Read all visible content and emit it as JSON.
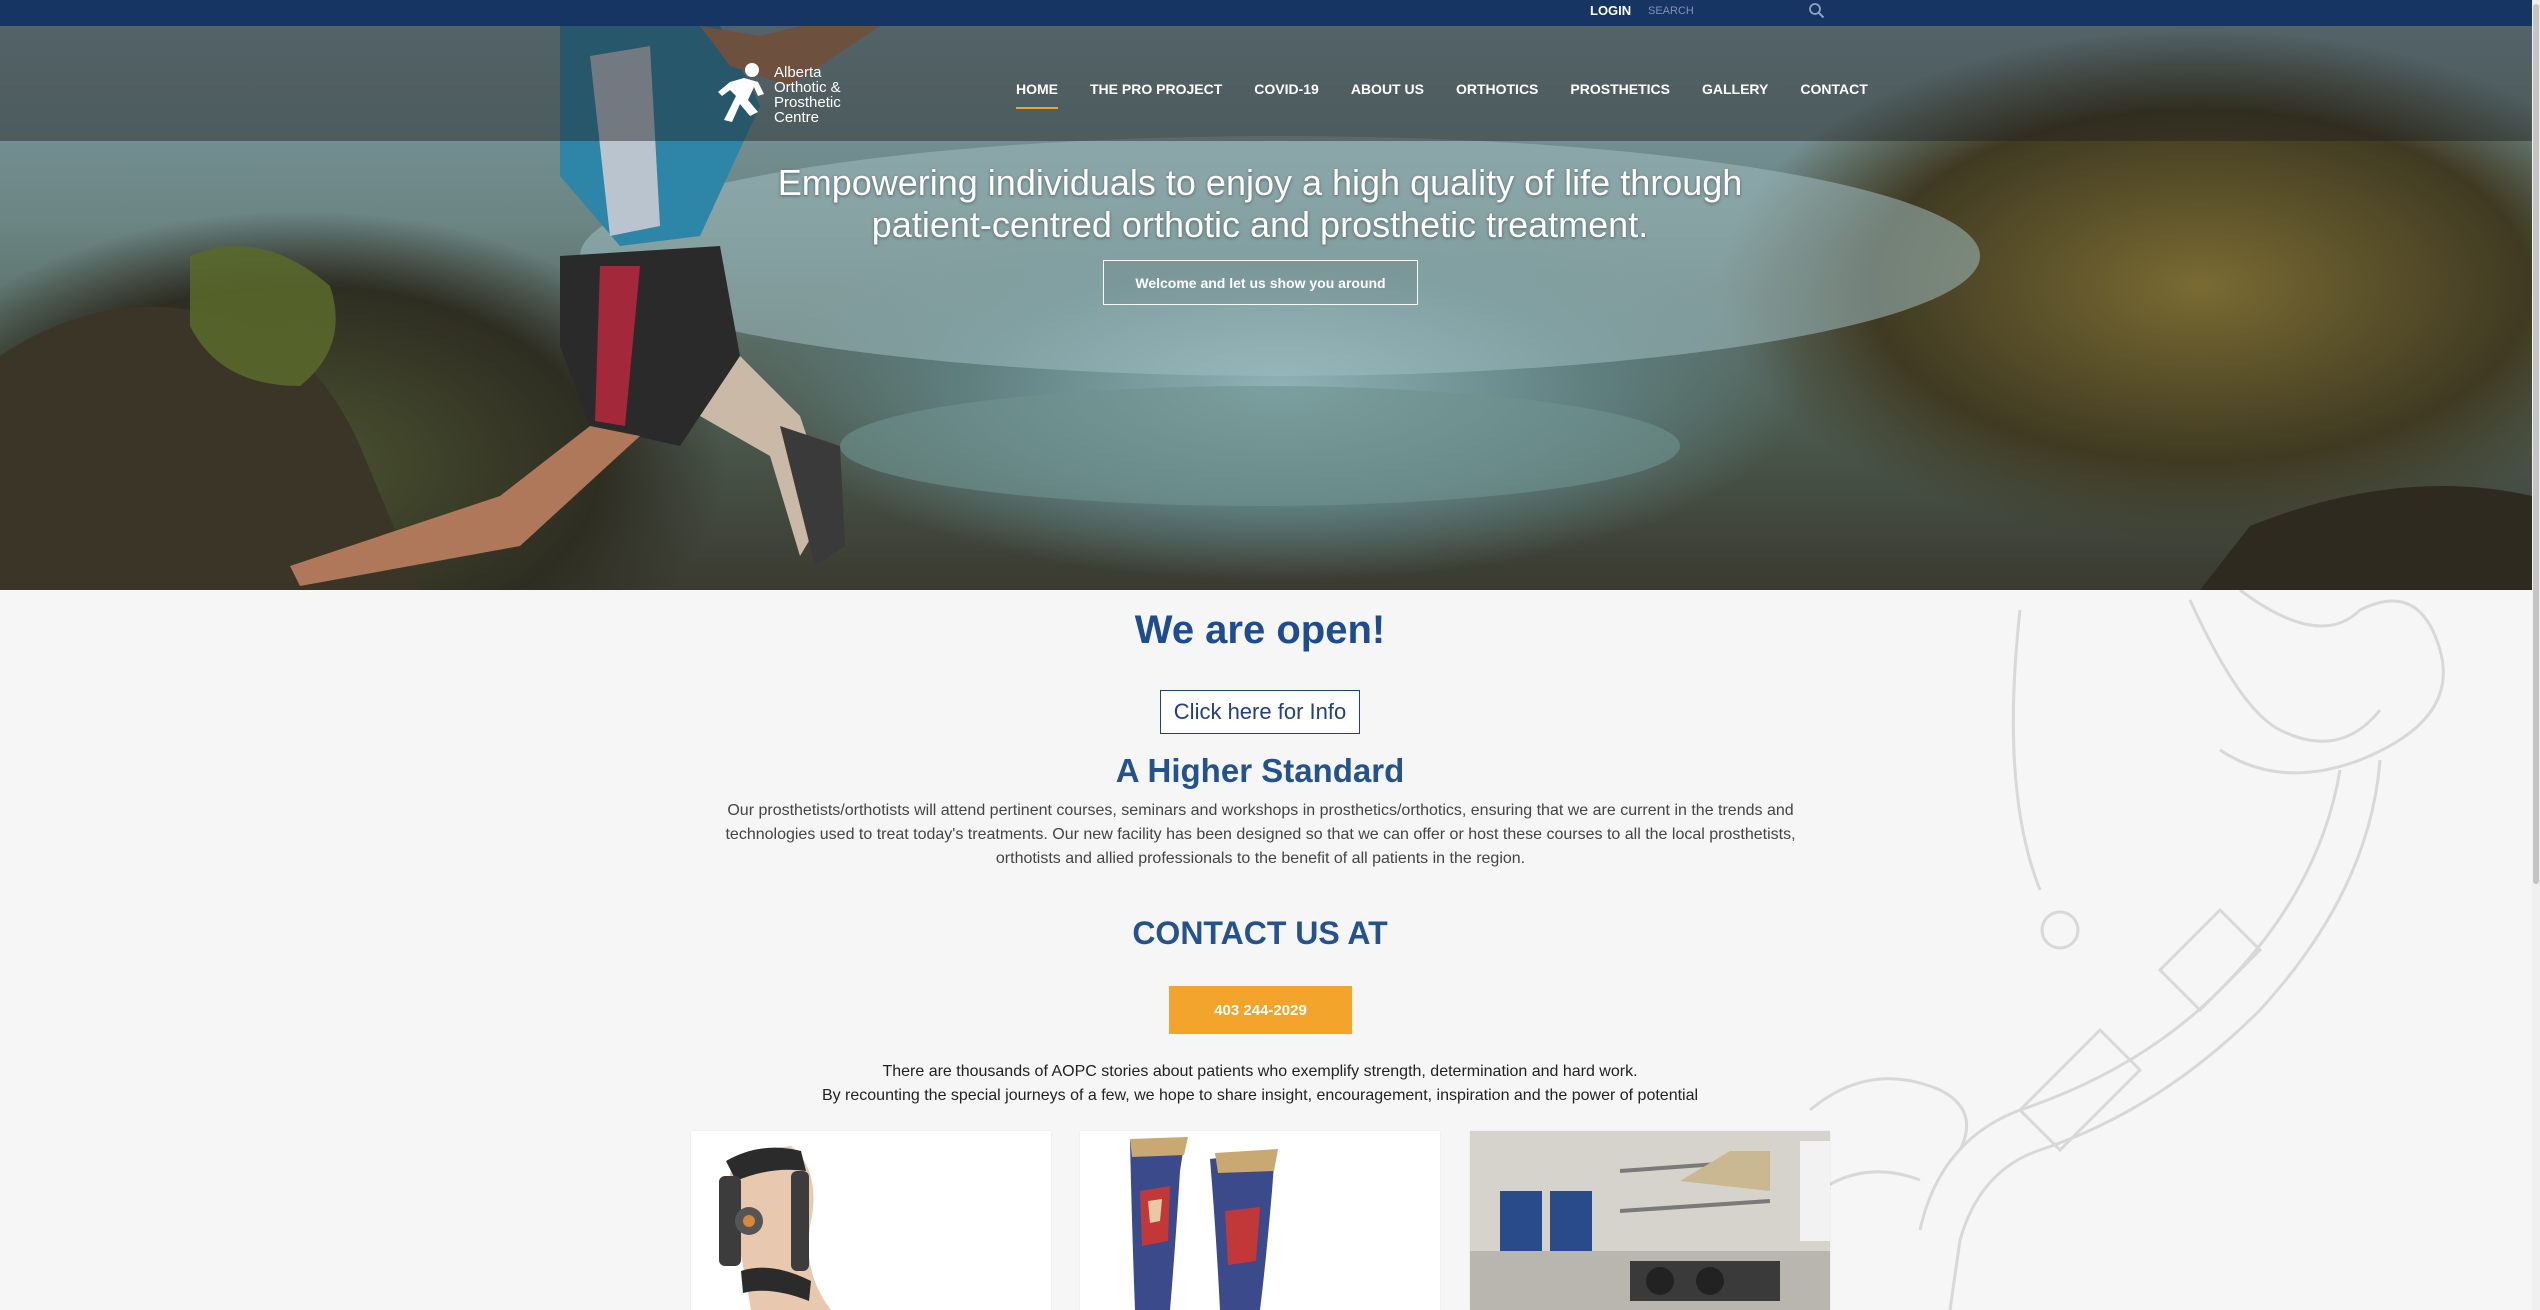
{
  "topbar": {
    "login_label": "LOGIN",
    "search_placeholder": "SEARCH"
  },
  "header": {
    "logo_text": "Alberta Orthotic & Prosthetic Centre",
    "nav": [
      {
        "label": "HOME",
        "active": true
      },
      {
        "label": "THE PRO PROJECT"
      },
      {
        "label": "COVID-19"
      },
      {
        "label": "ABOUT US"
      },
      {
        "label": "ORTHOTICS"
      },
      {
        "label": "PROSTHETICS"
      },
      {
        "label": "GALLERY"
      },
      {
        "label": "CONTACT"
      }
    ]
  },
  "hero": {
    "title_line1": "Empowering individuals to enjoy a high quality of life through",
    "title_line2": "patient-centred orthotic and prosthetic treatment.",
    "button_label": "Welcome and let us show you around"
  },
  "main": {
    "open_title": "We are open!",
    "info_button": "Click here for Info",
    "standard_title": "A Higher Standard",
    "standard_body": "Our prosthetists/orthotists will attend pertinent courses, seminars and workshops in prosthetics/orthotics, ensuring that we are current in the trends and technologies used to treat today's treatments. Our new facility has been designed so that we can offer or host these courses to all the local prosthetists, orthotists and allied professionals to the benefit of all patients in the region.",
    "contact_title": "CONTACT US AT",
    "phone_button": "403 244-2029",
    "stories_line1": "There are thousands of AOPC stories about patients who exemplify strength, determination and hard work.",
    "stories_line2": "By recounting the special journeys of a few, we hope to share insight, encouragement, inspiration and the power of potential"
  },
  "colors": {
    "topbar": "#163563",
    "accent": "#f3a42a",
    "heading_blue": "#24528f"
  },
  "icons": {
    "search": "search-icon",
    "logo": "runner-logo-icon"
  }
}
